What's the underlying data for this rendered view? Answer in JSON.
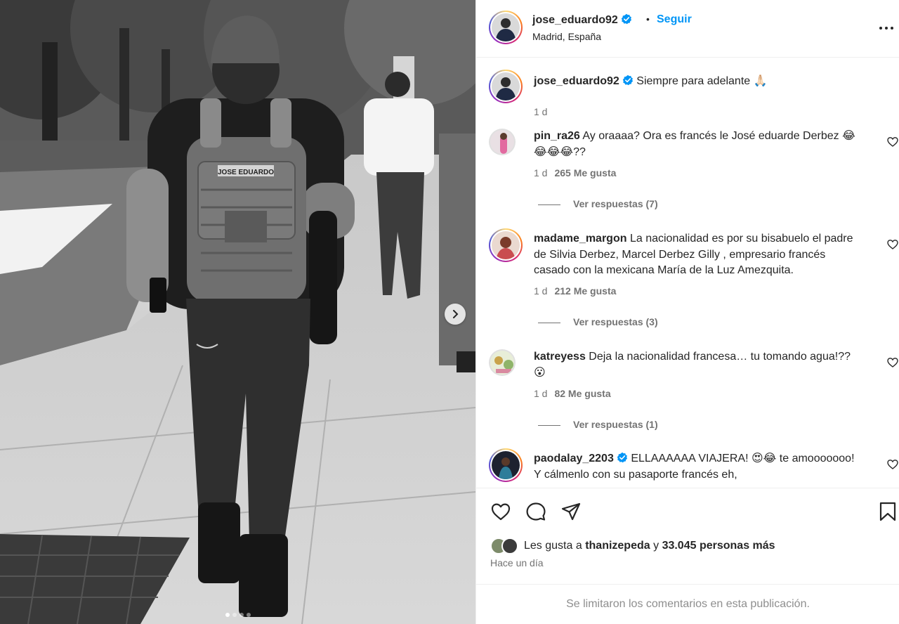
{
  "post": {
    "username": "jose_eduardo92",
    "follow_label": "Seguir",
    "separator": "•",
    "location": "Madrid, España",
    "caption": "Siempre para adelante 🙏🏻",
    "caption_age": "1 d",
    "backpack_label": "JOSE EDUARDO",
    "carousel_dots": 4,
    "carousel_active": 1
  },
  "comments": [
    {
      "username": "pin_ra26",
      "text": "Ay oraaaa? Ora es francés le José eduarde Derbez 😂😂😂😂??",
      "age": "1 d",
      "likes": "265 Me gusta",
      "replies": "Ver respuestas (7)"
    },
    {
      "username": "madame_margon",
      "text": "La nacionalidad es por su bisabuelo el padre de Silvia Derbez, Marcel Derbez Gilly , empresario francés casado con la mexicana María de la Luz Amezquita.",
      "age": "1 d",
      "likes": "212 Me gusta",
      "replies": "Ver respuestas (3)"
    },
    {
      "username": "katreyess",
      "text": "Deja la nacionalidad francesa… tu tomando agua!?? 😮",
      "age": "1 d",
      "likes": "82 Me gusta",
      "replies": "Ver respuestas (1)"
    },
    {
      "username": "paodalay_2203",
      "verified": true,
      "text": "ELLAAAAAA VIAJERA! 😍😂 te amooooooo! Y cálmenlo con su pasaporte francés eh,"
    }
  ],
  "likes_summary": {
    "prefix": "Les gusta a",
    "user": "thanizepeda",
    "conjunction": "y",
    "others": "33.045 personas más"
  },
  "posted_time": "Hace un día",
  "comments_limited": "Se limitaron los comentarios en esta publicación.",
  "colors": {
    "accent": "#0095f6",
    "verified": "#0095f6",
    "muted": "#737373"
  },
  "icons": [
    "chevron-right-icon",
    "more-icon",
    "verified-icon",
    "heart-icon",
    "comment-icon",
    "share-icon",
    "bookmark-icon"
  ]
}
